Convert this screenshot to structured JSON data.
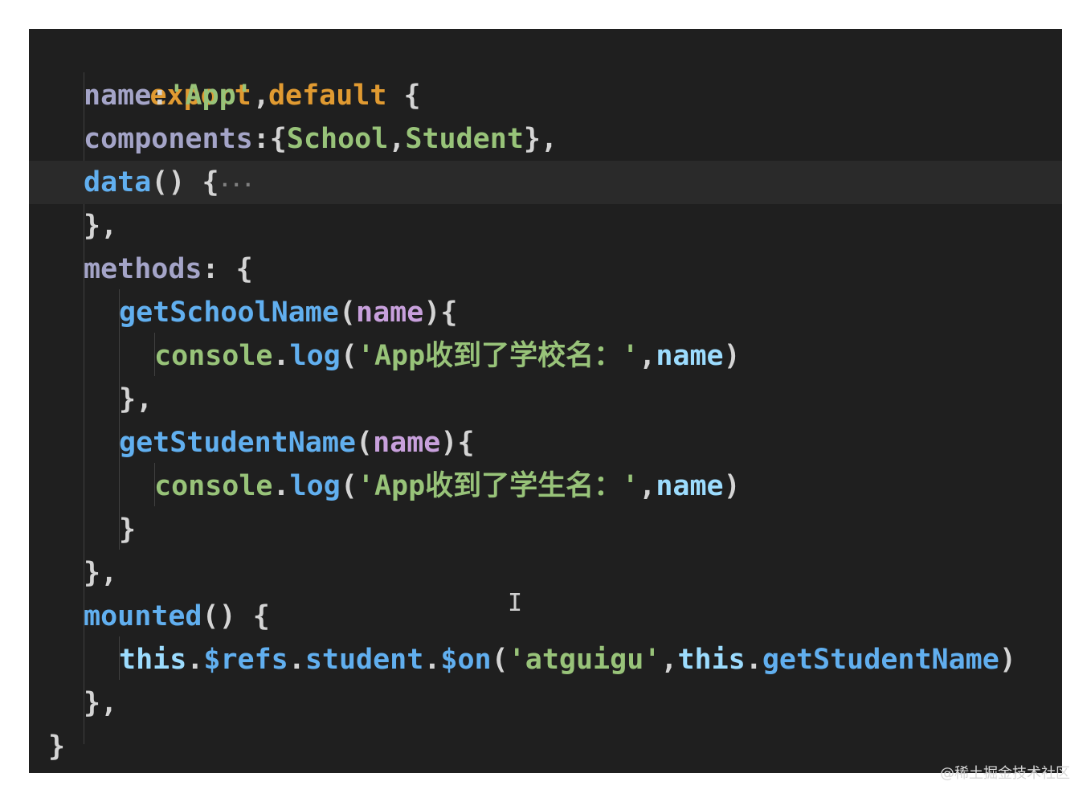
{
  "code": {
    "l1": {
      "kw1": "export",
      "kw2": "default",
      "brace": "{"
    },
    "l2": {
      "key": "name",
      "colon": ":",
      "str": "'App'",
      "comma": ","
    },
    "l3": {
      "key": "components",
      "colon": ":",
      "open": "{",
      "a": "School",
      "sep": ",",
      "b": "Student",
      "close": "},",
      "tail": ""
    },
    "l4": {
      "fn": "data",
      "parens": "()",
      "brace": "{",
      "fold": "···"
    },
    "l5": {
      "text": "},"
    },
    "l6": {
      "key": "methods",
      "colon": ":",
      "brace": "{"
    },
    "l7": {
      "fn": "getSchoolName",
      "open": "(",
      "param": "name",
      "close": "){"
    },
    "l8": {
      "obj": "console",
      "dot": ".",
      "fn": "log",
      "open": "(",
      "str": "'App收到了学校名：'",
      "sep": ",",
      "arg": "name",
      "close": ")"
    },
    "l9": {
      "text": "},"
    },
    "l10": {
      "fn": "getStudentName",
      "open": "(",
      "param": "name",
      "close": "){"
    },
    "l11": {
      "obj": "console",
      "dot": ".",
      "fn": "log",
      "open": "(",
      "str": "'App收到了学生名：'",
      "sep": ",",
      "arg": "name",
      "close": ")"
    },
    "l12": {
      "text": "}"
    },
    "l13": {
      "text": "},"
    },
    "l14": {
      "fn": "mounted",
      "parens": "()",
      "brace": "{"
    },
    "l15": {
      "this1": "this",
      "d1": ".",
      "refs": "$refs",
      "d2": ".",
      "student": "student",
      "d3": ".",
      "on": "$on",
      "open": "(",
      "str": "'atguigu'",
      "sep": ",",
      "this2": "this",
      "d4": ".",
      "handler": "getStudentName",
      "close": ")"
    },
    "l16": {
      "text": "},"
    },
    "l17": {
      "text": "}"
    }
  },
  "watermark": "@稀土掘金技术社区",
  "colors": {
    "background": "#1f1f1f",
    "keyword": "#e09a31",
    "property": "#9cdcfe",
    "function": "#61afef",
    "string": "#98c379",
    "parameter": "#c8a0dc"
  }
}
